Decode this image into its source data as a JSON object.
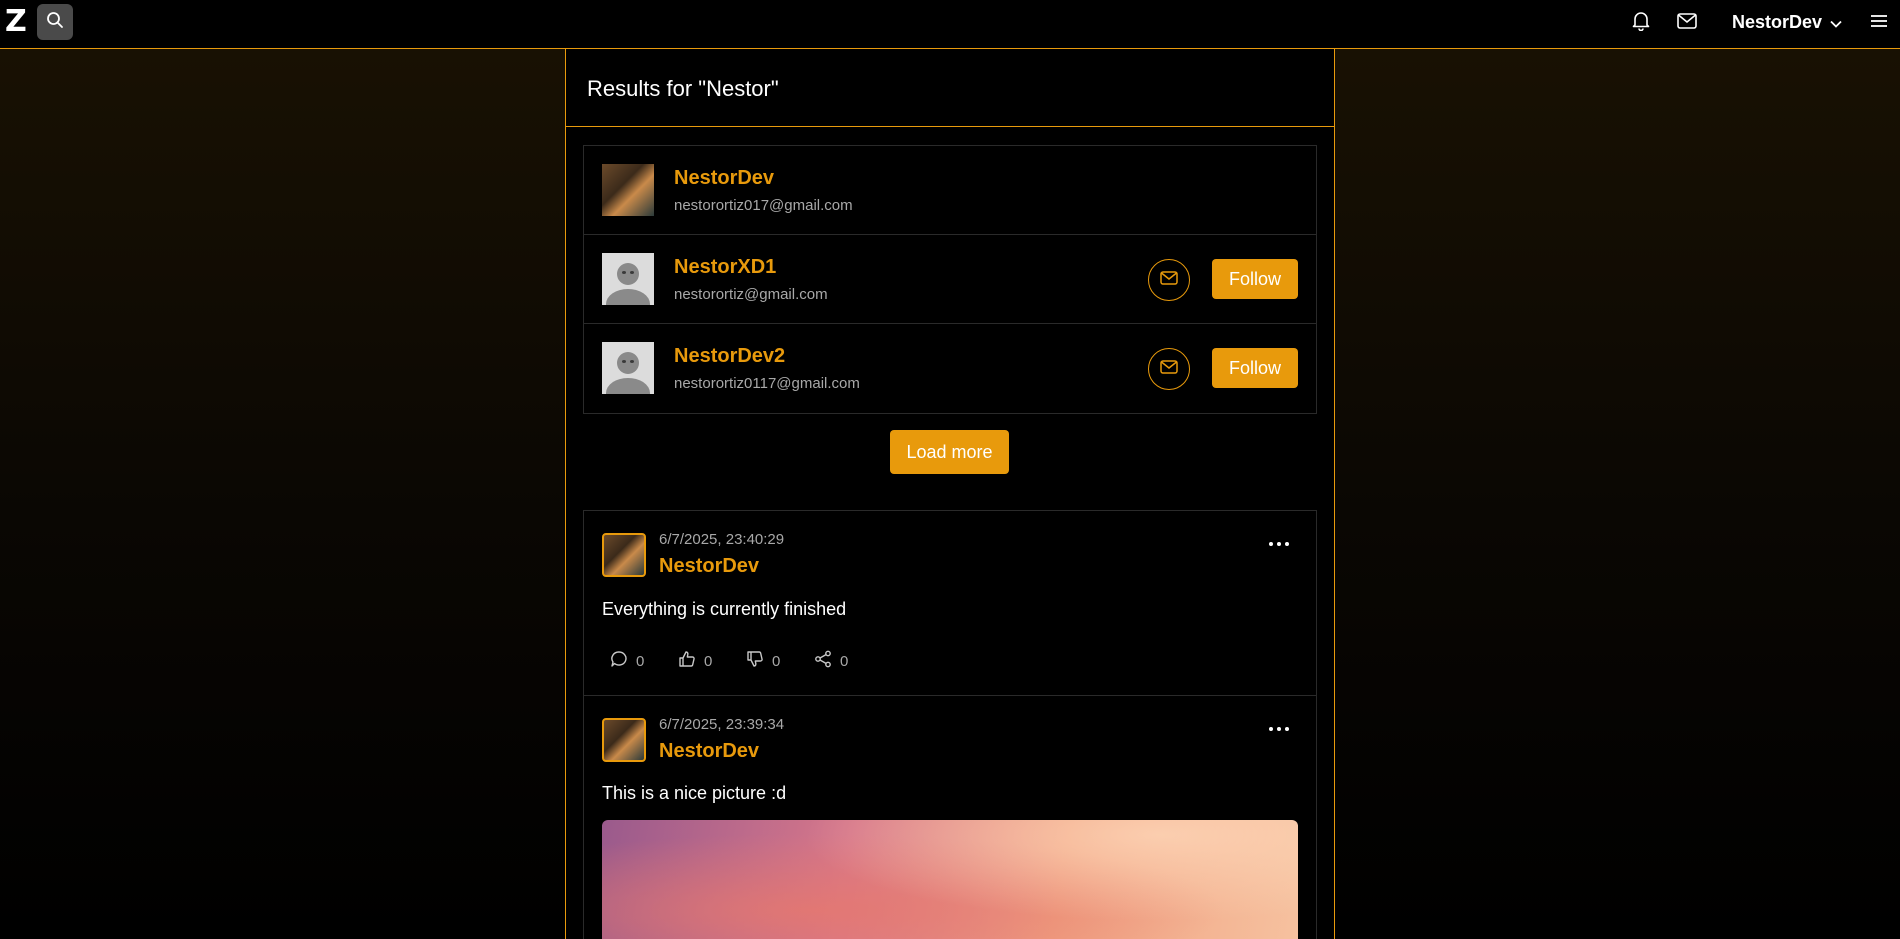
{
  "app": {
    "logo_text": "Z",
    "icons": {
      "search": "search-icon",
      "notifications": "bell-icon",
      "messages": "mail-icon",
      "menu": "hamburger-icon"
    },
    "accent_color": "#e89a0c",
    "username": "NestorDev"
  },
  "results": {
    "title": "Results for \"Nestor\""
  },
  "users": [
    {
      "name": "NestorDev",
      "email": "nestorortiz017@gmail.com",
      "avatar": "photo",
      "show_actions": false
    },
    {
      "name": "NestorXD1",
      "email": "nestorortiz@gmail.com",
      "avatar": "default",
      "show_actions": true,
      "follow_label": "Follow"
    },
    {
      "name": "NestorDev2",
      "email": "nestorortiz0117@gmail.com",
      "avatar": "default",
      "show_actions": true,
      "follow_label": "Follow"
    }
  ],
  "load_more_label": "Load more",
  "posts": [
    {
      "date": "6/7/2025, 23:40:29",
      "author": "NestorDev",
      "text": "Everything is currently finished",
      "comments": "0",
      "likes": "0",
      "dislikes": "0",
      "shares": "0"
    },
    {
      "date": "6/7/2025, 23:39:34",
      "author": "NestorDev",
      "text": "This is a nice picture :d",
      "has_image": true
    }
  ]
}
